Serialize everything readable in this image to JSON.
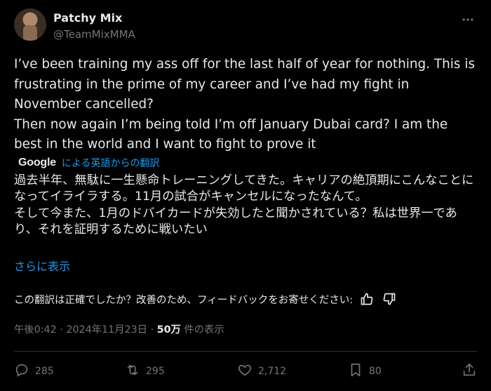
{
  "user": {
    "name": "Patchy Mix",
    "handle": "@TeamMixMMA"
  },
  "tweet": {
    "paragraphs": [
      "I’ve been training my ass off for  the last half of year for nothing. This is frustrating in the prime of my career and I’ve had my fight in November cancelled?",
      "Then now again I’m being told I’m off January Dubai card? I am the best in the world and I want to fight to prove it"
    ]
  },
  "translation": {
    "provider": "Google",
    "link_label": "による英語からの翻訳",
    "paragraphs": [
      "過去半年、無駄に一生懸命トレーニングしてきた。キャリアの絶頂期にこんなことになってイライラする。11月の試合がキャンセルになったなんて。",
      "そして今また、1月のドバイカードが失効したと聞かされている？私は世界一であり、それを証明するために戦いたい"
    ],
    "show_more": "さらに表示",
    "feedback_prompt": "この翻訳は正確でしたか？改善のため、フィードバックをお寄せください:"
  },
  "meta": {
    "time": "午後0:42",
    "date": "2024年11月23日",
    "separator": "·",
    "views_count": "50万",
    "views_label": "件の表示"
  },
  "actions": {
    "replies": "285",
    "reposts": "295",
    "likes": "2,712",
    "bookmarks": "80"
  },
  "icons": {
    "more": "more-dots-icon",
    "thumbs_up": "thumbs-up-icon",
    "thumbs_down": "thumbs-down-icon",
    "reply": "reply-icon",
    "repost": "repost-icon",
    "like": "heart-icon",
    "bookmark": "bookmark-icon",
    "share": "share-icon"
  },
  "colors": {
    "background": "#000000",
    "text": "#e7e9ea",
    "secondary": "#71767b",
    "link": "#1d9bf0",
    "divider": "#2f3336"
  }
}
